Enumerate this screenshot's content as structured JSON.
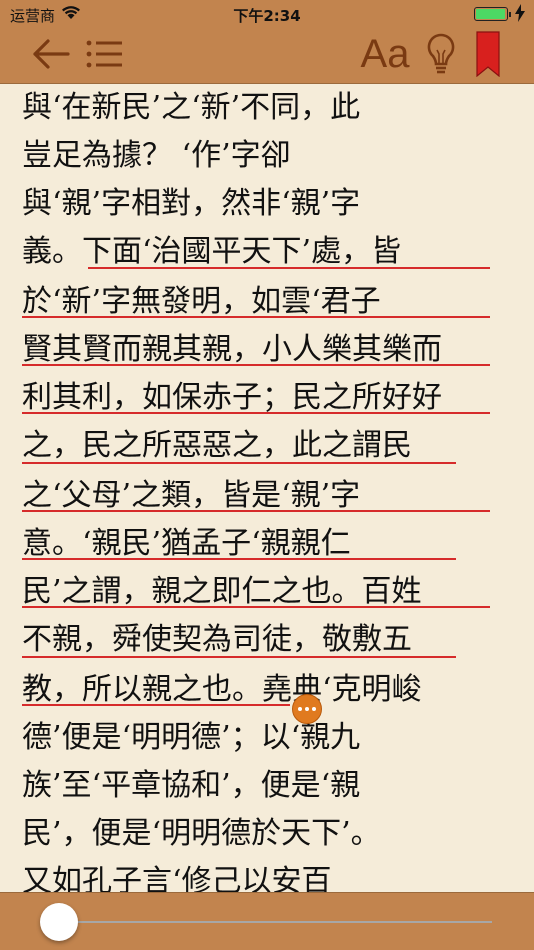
{
  "status": {
    "carrier": "运营商",
    "time": "下午2:34"
  },
  "toolbar": {
    "font_label": "Aa"
  },
  "lines": [
    "與‘在新民’之‘新’不同，此",
    "豈足為據？ ‘作’字卻",
    "與‘親’字相對，然非‘親’字",
    "義。下面‘治國平天下’處，皆",
    "於‘新’字無發明，如雲‘君子",
    "賢其賢而親其親，小人樂其樂而",
    "利其利，如保赤子；民之所好好",
    "之，民之所惡惡之，此之謂民",
    "之‘父母’之類，皆是‘親’字",
    "意。‘親民’猶孟子‘親親仁",
    "民’之謂，親之即仁之也。百姓",
    "不親，舜使契為司徒，敬敷五",
    "教，所以親之也。堯典‘克明峻",
    "德’便是‘明明德’；以‘親九",
    "族’至‘平章協和’，便是‘親",
    "民’，便是‘明明德於天下’。",
    "又如孔子言‘修己以安百"
  ],
  "progress": {
    "fraction": 0.0
  },
  "colors": {
    "bar": "#c2844e",
    "page": "#f5ecd9",
    "highlight": "#d62b2b",
    "accent": "#7a3a12"
  }
}
